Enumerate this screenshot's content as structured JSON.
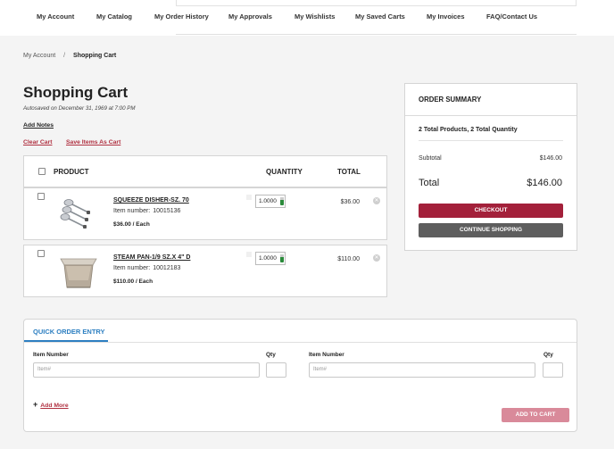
{
  "nav": {
    "items": [
      "My Account",
      "My Catalog",
      "My Order History",
      "My Approvals",
      "My Wishlists",
      "My Saved Carts",
      "My Invoices",
      "FAQ/Contact Us"
    ]
  },
  "breadcrumb": {
    "root": "My Account",
    "separator": "/",
    "current": "Shopping Cart"
  },
  "cart": {
    "title": "Shopping Cart",
    "autosaved": "Autosaved on December 31, 1969 at 7:00 PM",
    "add_notes": "Add Notes",
    "clear_cart": "Clear Cart",
    "save_items": "Save Items As Cart",
    "columns": {
      "product": "PRODUCT",
      "quantity": "QUANTITY",
      "total": "TOTAL"
    },
    "items": [
      {
        "name": "SQUEEZE DISHER-SZ. 70",
        "item_number_label": "Item number:",
        "item_number": "10015136",
        "unit_price": "$36.00 / Each",
        "quantity": "1.0000",
        "total": "$36.00",
        "image_icon": "disher-product-icon"
      },
      {
        "name": "STEAM PAN-1/9 SZ.X 4\" D",
        "item_number_label": "Item number:",
        "item_number": "10012183",
        "unit_price": "$110.00 / Each",
        "quantity": "1.0000",
        "total": "$110.00",
        "image_icon": "steam-pan-product-icon"
      }
    ]
  },
  "summary": {
    "title": "ORDER SUMMARY",
    "products_line": "2 Total Products, 2 Total Quantity",
    "subtotal_label": "Subtotal",
    "subtotal_value": "$146.00",
    "total_label": "Total",
    "total_value": "$146.00",
    "checkout": "CHECKOUT",
    "continue": "CONTINUE SHOPPING"
  },
  "quick_order": {
    "tab": "QUICK ORDER ENTRY",
    "item_label": "Item Number",
    "qty_label": "Qty",
    "item_placeholder": "Item#",
    "add_more": "Add More",
    "add_to_cart": "ADD TO CART"
  },
  "colors": {
    "accent_red": "#a3203a",
    "link_red": "#b03040",
    "tab_blue": "#2d7fc1",
    "continue_gray": "#5e5e5e",
    "disabled_pink": "#d98a9a"
  }
}
